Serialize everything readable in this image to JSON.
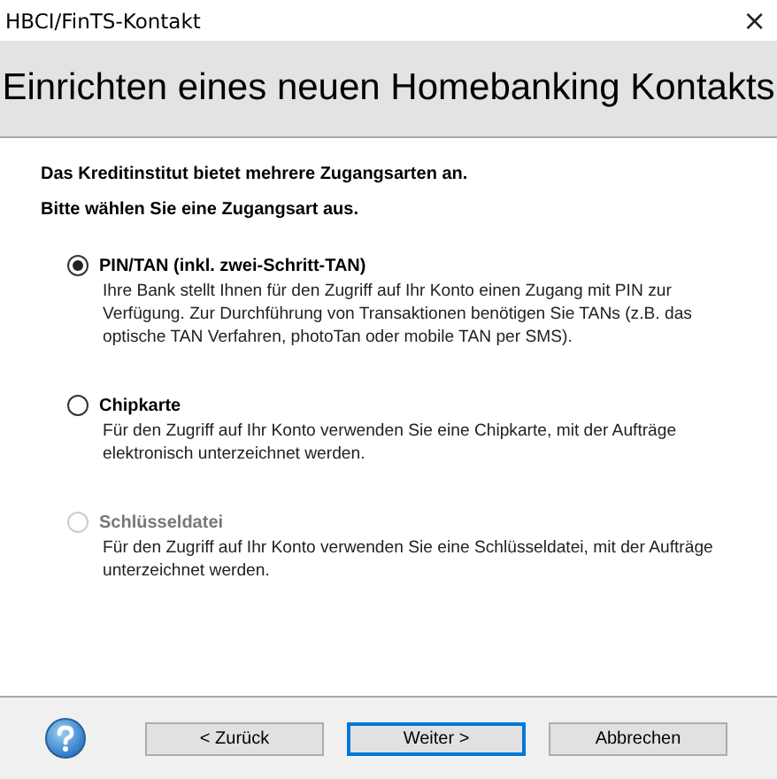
{
  "window": {
    "title": "HBCI/FinTS-Kontakt",
    "close": "×"
  },
  "header": {
    "title": "Einrichten eines neuen Homebanking Kontakts"
  },
  "intro": [
    "Das Kreditinstitut bietet mehrere Zugangsarten an.",
    "Bitte wählen Sie eine Zugangsart aus."
  ],
  "options": [
    {
      "label": "PIN/TAN (inkl. zwei-Schritt-TAN)",
      "description": "Ihre Bank stellt Ihnen für den Zugriff auf Ihr Konto einen Zugang mit PIN zur Verfügung. Zur Durchführung von Transaktionen benötigen Sie TANs (z.B. das optische TAN Verfahren, photoTan oder mobile TAN per SMS).",
      "selected": true,
      "disabled": false
    },
    {
      "label": "Chipkarte",
      "description": "Für den Zugriff auf Ihr Konto verwenden Sie eine Chipkarte, mit der Aufträge elektronisch unterzeichnet werden.",
      "selected": false,
      "disabled": false
    },
    {
      "label": "Schlüsseldatei",
      "description": "Für den Zugriff auf Ihr Konto verwenden Sie eine Schlüsseldatei, mit der Aufträge unterzeichnet werden.",
      "selected": false,
      "disabled": true
    }
  ],
  "buttons": [
    {
      "label": "< Zurück",
      "default": false
    },
    {
      "label": "Weiter >",
      "default": true
    },
    {
      "label": "Abbrechen",
      "default": false
    }
  ]
}
